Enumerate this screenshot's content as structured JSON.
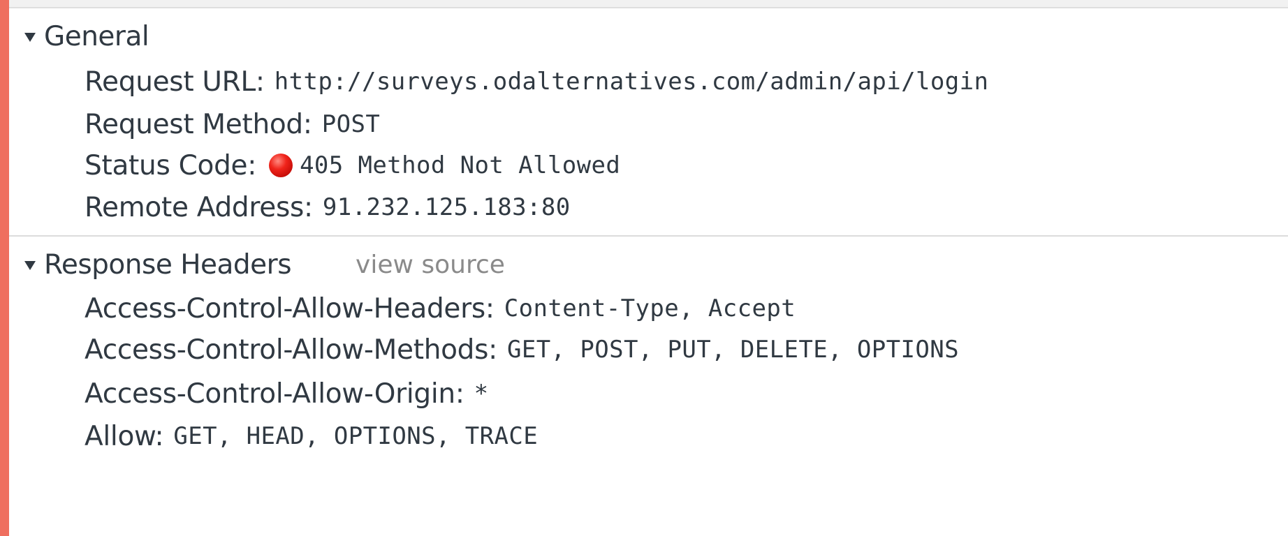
{
  "general": {
    "title": "General",
    "rows": [
      {
        "key": "Request URL:",
        "value": "http://surveys.odalternatives.com/admin/api/login"
      },
      {
        "key": "Request Method:",
        "value": "POST"
      },
      {
        "key": "Status Code:",
        "value": "405 Method Not Allowed",
        "status_color": "#e8231c"
      },
      {
        "key": "Remote Address:",
        "value": "91.232.125.183:80"
      }
    ]
  },
  "response_headers": {
    "title": "Response Headers",
    "view_source_label": "view source",
    "rows": [
      {
        "key": "Access-Control-Allow-Headers:",
        "value": "Content-Type, Accept"
      },
      {
        "key": "Access-Control-Allow-Methods:",
        "value": "GET, POST, PUT, DELETE, OPTIONS"
      },
      {
        "key": "Access-Control-Allow-Origin:",
        "value": "*"
      },
      {
        "key": "Allow:",
        "value": "GET, HEAD, OPTIONS, TRACE"
      }
    ]
  },
  "icons": {
    "section_toggle": "triangle-down-icon",
    "status_indicator": "red-dot-icon"
  },
  "colors": {
    "frame_border": "#ef6f5f",
    "text": "#303942",
    "muted_text": "#8a8a8a",
    "status_error": "#e8231c"
  }
}
